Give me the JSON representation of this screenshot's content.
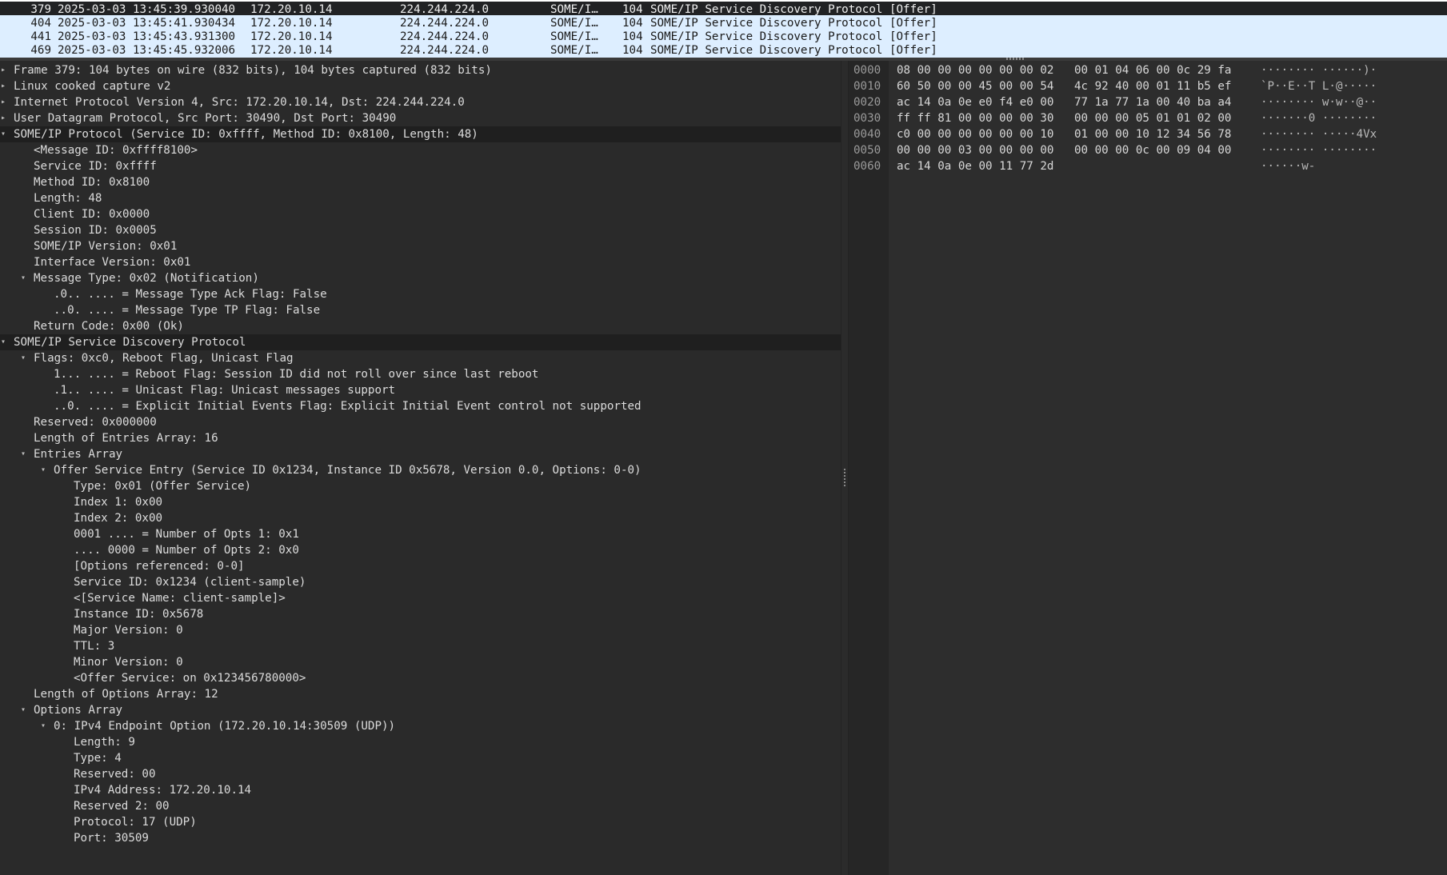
{
  "packet_list": {
    "rows": [
      {
        "no": "379",
        "time": "2025-03-03 13:45:39.930040",
        "src": "172.20.10.14",
        "dst": "224.244.224.0",
        "proto": "SOME/I…",
        "len": "104",
        "info": "SOME/IP Service Discovery Protocol [Offer]"
      },
      {
        "no": "404",
        "time": "2025-03-03 13:45:41.930434",
        "src": "172.20.10.14",
        "dst": "224.244.224.0",
        "proto": "SOME/I…",
        "len": "104",
        "info": "SOME/IP Service Discovery Protocol [Offer]"
      },
      {
        "no": "441",
        "time": "2025-03-03 13:45:43.931300",
        "src": "172.20.10.14",
        "dst": "224.244.224.0",
        "proto": "SOME/I…",
        "len": "104",
        "info": "SOME/IP Service Discovery Protocol [Offer]"
      },
      {
        "no": "469",
        "time": "2025-03-03 13:45:45.932006",
        "src": "172.20.10.14",
        "dst": "224.244.224.0",
        "proto": "SOME/I…",
        "len": "104",
        "info": "SOME/IP Service Discovery Protocol [Offer]"
      }
    ]
  },
  "details": {
    "lines": [
      {
        "text": "Frame 379: 104 bytes on wire (832 bits), 104 bytes captured (832 bits)",
        "arrow": "▸"
      },
      {
        "text": "Linux cooked capture v2",
        "arrow": "▸"
      },
      {
        "text": "Internet Protocol Version 4, Src: 172.20.10.14, Dst: 224.244.224.0",
        "arrow": "▸"
      },
      {
        "text": "User Datagram Protocol, Src Port: 30490, Dst Port: 30490",
        "arrow": "▸"
      },
      {
        "text": "SOME/IP Protocol (Service ID: 0xffff, Method ID: 0x8100, Length: 48)",
        "arrow": "▾"
      },
      {
        "text": "<Message ID: 0xffff8100>",
        "arrow": ""
      },
      {
        "text": "Service ID: 0xffff",
        "arrow": ""
      },
      {
        "text": "Method ID: 0x8100",
        "arrow": ""
      },
      {
        "text": "Length: 48",
        "arrow": ""
      },
      {
        "text": "Client ID: 0x0000",
        "arrow": ""
      },
      {
        "text": "Session ID: 0x0005",
        "arrow": ""
      },
      {
        "text": "SOME/IP Version: 0x01",
        "arrow": ""
      },
      {
        "text": "Interface Version: 0x01",
        "arrow": ""
      },
      {
        "text": "Message Type: 0x02 (Notification)",
        "arrow": "▾"
      },
      {
        "text": ".0.. .... = Message Type Ack Flag: False",
        "arrow": ""
      },
      {
        "text": "..0. .... = Message Type TP Flag: False",
        "arrow": ""
      },
      {
        "text": "Return Code: 0x00 (Ok)",
        "arrow": ""
      },
      {
        "text": "SOME/IP Service Discovery Protocol",
        "arrow": "▾"
      },
      {
        "text": "Flags: 0xc0, Reboot Flag, Unicast Flag",
        "arrow": "▾"
      },
      {
        "text": "1... .... = Reboot Flag: Session ID did not roll over since last reboot",
        "arrow": ""
      },
      {
        "text": ".1.. .... = Unicast Flag: Unicast messages support",
        "arrow": ""
      },
      {
        "text": "..0. .... = Explicit Initial Events Flag: Explicit Initial Event control not supported",
        "arrow": ""
      },
      {
        "text": "Reserved: 0x000000",
        "arrow": ""
      },
      {
        "text": "Length of Entries Array: 16",
        "arrow": ""
      },
      {
        "text": "Entries Array",
        "arrow": "▾"
      },
      {
        "text": "Offer Service Entry (Service ID 0x1234, Instance ID 0x5678, Version 0.0, Options: 0-0)",
        "arrow": "▾"
      },
      {
        "text": "Type: 0x01 (Offer Service)",
        "arrow": ""
      },
      {
        "text": "Index 1: 0x00",
        "arrow": ""
      },
      {
        "text": "Index 2: 0x00",
        "arrow": ""
      },
      {
        "text": "0001 .... = Number of Opts 1: 0x1",
        "arrow": ""
      },
      {
        "text": ".... 0000 = Number of Opts 2: 0x0",
        "arrow": ""
      },
      {
        "text": "[Options referenced: 0-0]",
        "arrow": ""
      },
      {
        "text": "Service ID: 0x1234 (client-sample)",
        "arrow": ""
      },
      {
        "text": "<[Service Name: client-sample]>",
        "arrow": ""
      },
      {
        "text": "Instance ID: 0x5678",
        "arrow": ""
      },
      {
        "text": "Major Version: 0",
        "arrow": ""
      },
      {
        "text": "TTL: 3",
        "arrow": ""
      },
      {
        "text": "Minor Version: 0",
        "arrow": ""
      },
      {
        "text": "<Offer Service: on 0x123456780000>",
        "arrow": ""
      },
      {
        "text": "Length of Options Array: 12",
        "arrow": ""
      },
      {
        "text": "Options Array",
        "arrow": "▾"
      },
      {
        "text": "0: IPv4 Endpoint Option (172.20.10.14:30509 (UDP))",
        "arrow": "▾"
      },
      {
        "text": "Length: 9",
        "arrow": ""
      },
      {
        "text": "Type: 4",
        "arrow": ""
      },
      {
        "text": "Reserved: 00",
        "arrow": ""
      },
      {
        "text": "IPv4 Address: 172.20.10.14",
        "arrow": ""
      },
      {
        "text": "Reserved 2: 00",
        "arrow": ""
      },
      {
        "text": "Protocol: 17 (UDP)",
        "arrow": ""
      },
      {
        "text": "Port: 30509",
        "arrow": ""
      }
    ]
  },
  "bytes": {
    "rows": [
      {
        "offset": "0000",
        "hex1": "08 00 00 00 00 00 00 02",
        "hex2": "00 01 04 06 00 0c 29 fa",
        "ascii": "········ ······)·"
      },
      {
        "offset": "0010",
        "hex1": "60 50 00 00 45 00 00 54",
        "hex2": "4c 92 40 00 01 11 b5 ef",
        "ascii": "`P··E··T L·@·····"
      },
      {
        "offset": "0020",
        "hex1": "ac 14 0a 0e e0 f4 e0 00",
        "hex2": "77 1a 77 1a 00 40 ba a4",
        "ascii": "········ w·w··@··"
      },
      {
        "offset": "0030",
        "hex1": "ff ff 81 00 00 00 00 30",
        "hex2": "00 00 00 05 01 01 02 00",
        "ascii": "·······0 ········"
      },
      {
        "offset": "0040",
        "hex1": "c0 00 00 00 00 00 00 10",
        "hex2": "01 00 00 10 12 34 56 78",
        "ascii": "········ ·····4Vx"
      },
      {
        "offset": "0050",
        "hex1": "00 00 00 03 00 00 00 00",
        "hex2": "00 00 00 0c 00 09 04 00",
        "ascii": "········ ········"
      },
      {
        "offset": "0060",
        "hex1": "ac 14 0a 0e 00 11 77 2d",
        "hex2": "",
        "ascii": "······w-"
      }
    ]
  }
}
